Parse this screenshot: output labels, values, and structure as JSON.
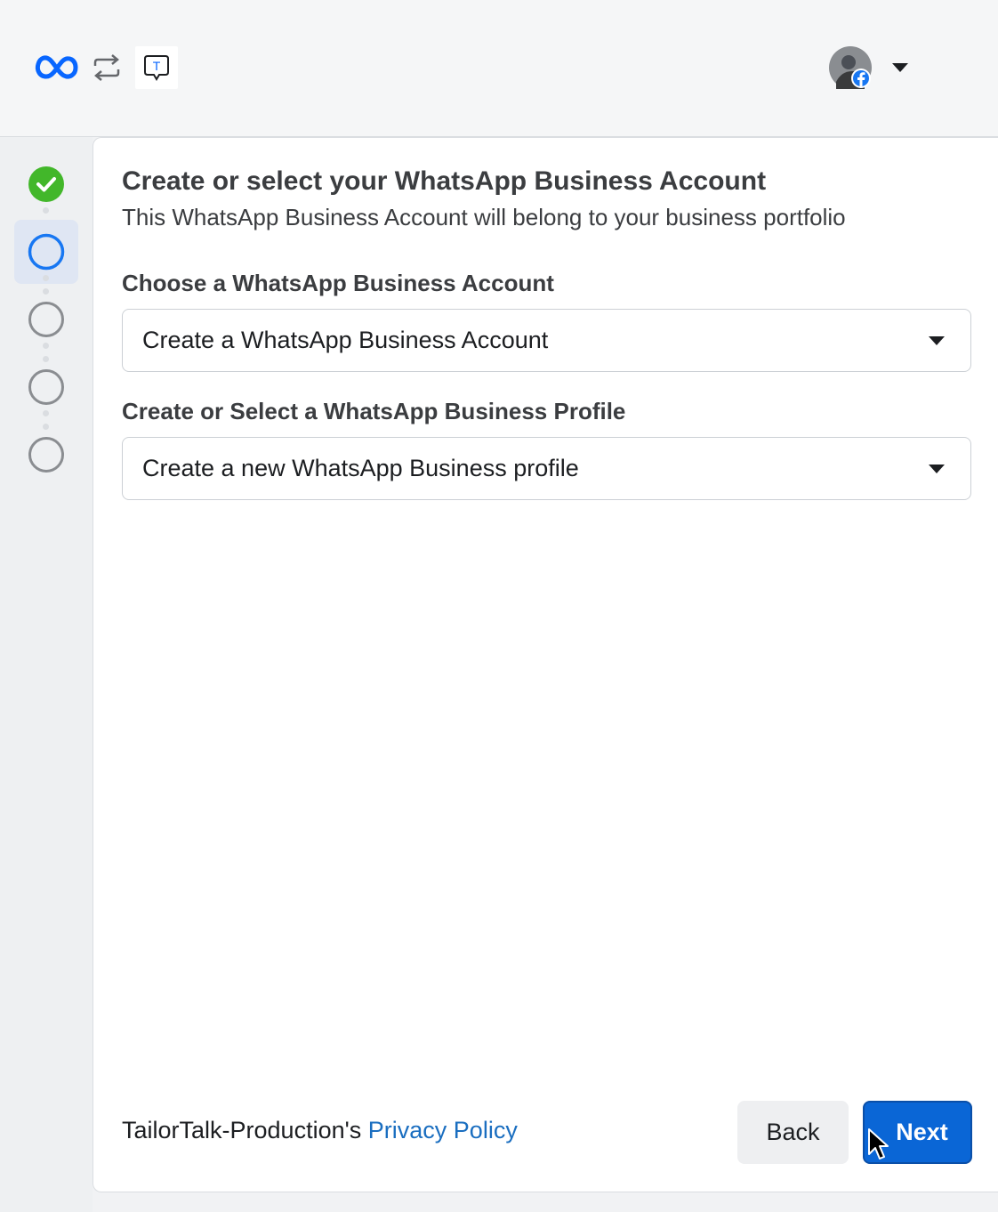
{
  "header": {
    "logo_icon": "meta-logo-icon",
    "switch_icon": "swap-arrows-icon",
    "app_badge_letter": "T",
    "avatar_icon": "profile-avatar-icon",
    "avatar_badge_icon": "facebook-icon",
    "menu_icon": "caret-down-icon"
  },
  "stepper": {
    "steps": [
      {
        "status": "completed",
        "icon": "check-icon"
      },
      {
        "status": "current"
      },
      {
        "status": "pending"
      },
      {
        "status": "pending"
      },
      {
        "status": "pending"
      }
    ]
  },
  "main": {
    "title": "Create or select your WhatsApp Business Account",
    "subtitle": "This WhatsApp Business Account will belong to your business portfolio",
    "account_field": {
      "label": "Choose a WhatsApp Business Account",
      "value": "Create a WhatsApp Business Account"
    },
    "profile_field": {
      "label": "Create or Select a WhatsApp Business Profile",
      "value": "Create a new WhatsApp Business profile"
    }
  },
  "footer": {
    "owner_text": "TailorTalk-Production's",
    "privacy_link": "Privacy Policy",
    "back_label": "Back",
    "next_label": "Next"
  },
  "colors": {
    "primary": "#0a66d6",
    "success": "#42b72a",
    "link": "#1a6ec0"
  }
}
